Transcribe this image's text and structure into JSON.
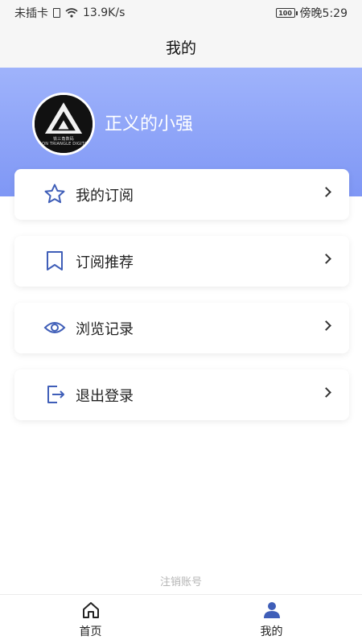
{
  "status_bar": {
    "carrier": "未插卡",
    "speed": "13.9K/s",
    "battery": "100",
    "time": "傍晚5:29"
  },
  "header": {
    "title": "我的"
  },
  "profile": {
    "username": "正义的小强",
    "avatar_caption_line1": "铁三角数码",
    "avatar_caption_line2": "IRON TRIANGLE DIGITAL"
  },
  "menu": {
    "items": [
      {
        "label": "我的订阅",
        "icon": "star-icon"
      },
      {
        "label": "订阅推荐",
        "icon": "bookmark-icon"
      },
      {
        "label": "浏览记录",
        "icon": "eye-icon"
      },
      {
        "label": "退出登录",
        "icon": "logout-icon"
      }
    ]
  },
  "footer": {
    "delete_account": "注销账号"
  },
  "bottom_nav": {
    "items": [
      {
        "label": "首页",
        "icon": "home-icon",
        "active": false
      },
      {
        "label": "我的",
        "icon": "user-icon",
        "active": true
      }
    ]
  },
  "colors": {
    "accent": "#3f5eb8",
    "header_gradient_top": "#9fb3fb",
    "header_gradient_bottom": "#7f97f5"
  }
}
